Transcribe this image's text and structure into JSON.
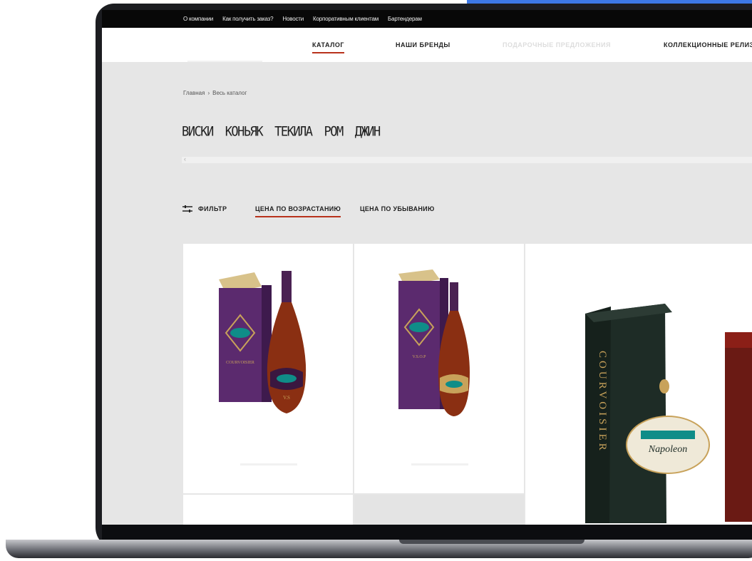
{
  "topbar": {
    "links": [
      "О компании",
      "Как получить заказ?",
      "Новости",
      "Корпоративным клиентам",
      "Бартендерам"
    ]
  },
  "nav": {
    "catalog": "КАТАЛОГ",
    "brands": "НАШИ БРЕНДЫ",
    "gifts": "ПОДАРОЧНЫЕ ПРЕДЛОЖЕНИЯ",
    "collection": "КОЛЛЕКЦИОННЫЕ РЕЛИЗЫ"
  },
  "breadcrumb": {
    "home": "Главная",
    "separator": "›",
    "current": "Весь каталог"
  },
  "categories": [
    "ВИСКИ",
    "КОНЬЯК",
    "ТЕКИЛА",
    "РОМ",
    "ДЖИН"
  ],
  "filter": {
    "label": "ФИЛЬТР"
  },
  "sort": {
    "ascending": "ЦЕНА ПО ВОЗРАСТАНИЮ",
    "descending": "ЦЕНА ПО УБЫВАНИЮ"
  },
  "products": {
    "box_brand": "COURVOISIER",
    "card1_label": "V.S",
    "card2_label": "V.S.O.P",
    "card3_label": "Napoleon"
  },
  "colors": {
    "accent": "#3d78e6",
    "underline": "#b8321c",
    "box_purple": "#5b2a6e",
    "gold": "#c8a25a"
  }
}
